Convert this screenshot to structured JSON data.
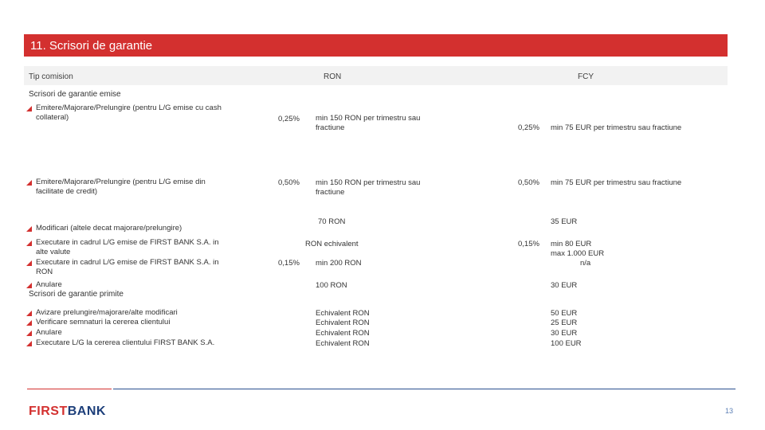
{
  "title": "11. Scrisori de garantie",
  "header": {
    "col1": "Tip comision",
    "col2": "RON",
    "col3": "FCY"
  },
  "sections": {
    "emise": "Scrisori de garantie emise",
    "primite": "Scrisori de garantie primite"
  },
  "rows": {
    "r1": {
      "label": "Emitere/Majorare/Prelungire (pentru L/G emise cu cash collateral)",
      "ron_pct": "0,25%",
      "ron_min": "min 150 RON per trimestru sau fractiune",
      "fcy_pct": "0,25%",
      "fcy_min": "min 75 EUR per trimestru sau fractiune"
    },
    "r2": {
      "label": "Emitere/Majorare/Prelungire (pentru L/G emise din facilitate de credit)",
      "ron_pct": "0,50%",
      "ron_min": "min 150 RON per trimestru sau fractiune",
      "fcy_pct": "0,50%",
      "fcy_min": "min 75 EUR per trimestru sau fractiune"
    },
    "r3": {
      "label": "Modificari (altele decat majorare/prelungire)",
      "ron": "70 RON",
      "fcy": "35 EUR"
    },
    "r4": {
      "label": "Executare in cadrul L/G emise de FIRST BANK S.A. in alte valute",
      "ron": "RON echivalent",
      "fcy_pct": "0,15%",
      "fcy_l1": "min 80 EUR",
      "fcy_l2": "max 1.000 EUR"
    },
    "r5": {
      "label": "Executare in cadrul L/G emise de FIRST BANK S.A. in RON",
      "ron_pct": "0,15%",
      "ron": "min 200 RON",
      "fcy": "n/a"
    },
    "r6": {
      "label": "Anulare",
      "ron": "100 RON",
      "fcy": "30 EUR"
    },
    "p1": {
      "label": "Avizare prelungire/majorare/alte modificari",
      "ron": "Echivalent RON",
      "fcy": "50 EUR"
    },
    "p2": {
      "label": "Verificare semnaturi la cererea clientului",
      "ron": "Echivalent RON",
      "fcy": "25 EUR"
    },
    "p3": {
      "label": "Anulare",
      "ron": "Echivalent RON",
      "fcy": "30 EUR"
    },
    "p4": {
      "label": "Executare L/G la cererea clientului FIRST BANK S.A.",
      "ron": "Echivalent RON",
      "fcy": "100 EUR"
    }
  },
  "footer": {
    "logo_left": "FIRST",
    "logo_right": "BANK",
    "page_number": "13"
  },
  "colors": {
    "accent": "#d3302f",
    "brand_blue": "#1d3f7a"
  }
}
